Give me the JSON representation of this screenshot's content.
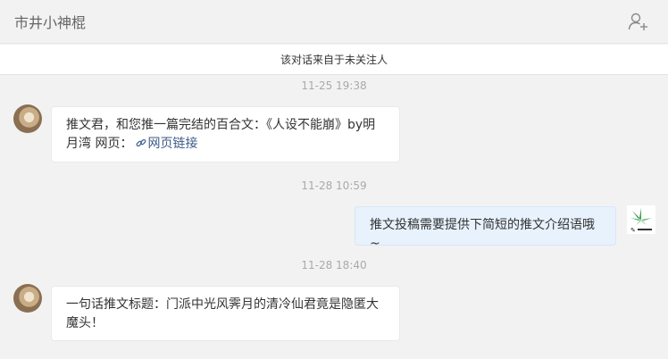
{
  "header": {
    "contact_name": "市井小神棍",
    "add_user_icon": "add-user-icon"
  },
  "notice": {
    "text": "该对话来自于未关注人"
  },
  "messages": [
    {
      "timestamp": "11-25 19:38",
      "direction": "incoming",
      "text_line1": "推文君，和您推一篇完结的百合文：《人设不能崩》by明",
      "text_line2": "月湾  网页：",
      "link_text": "网页链接",
      "link_icon": "link-icon"
    },
    {
      "timestamp": "11-28 10:59",
      "direction": "outgoing",
      "text": "推文投稿需要提供下简短的推文介绍语哦~"
    },
    {
      "timestamp": "11-28 18:40",
      "direction": "incoming",
      "text_line1": "一句话推文标题：门派中光风霁月的清冷仙君竟是隐匿大",
      "text_line2": "魔头！"
    }
  ],
  "colors": {
    "background": "#f2f2f2",
    "incoming_bubble": "#ffffff",
    "outgoing_bubble": "#e8f2fd",
    "timestamp": "#aaaaaa",
    "link": "#3c5a8a"
  }
}
